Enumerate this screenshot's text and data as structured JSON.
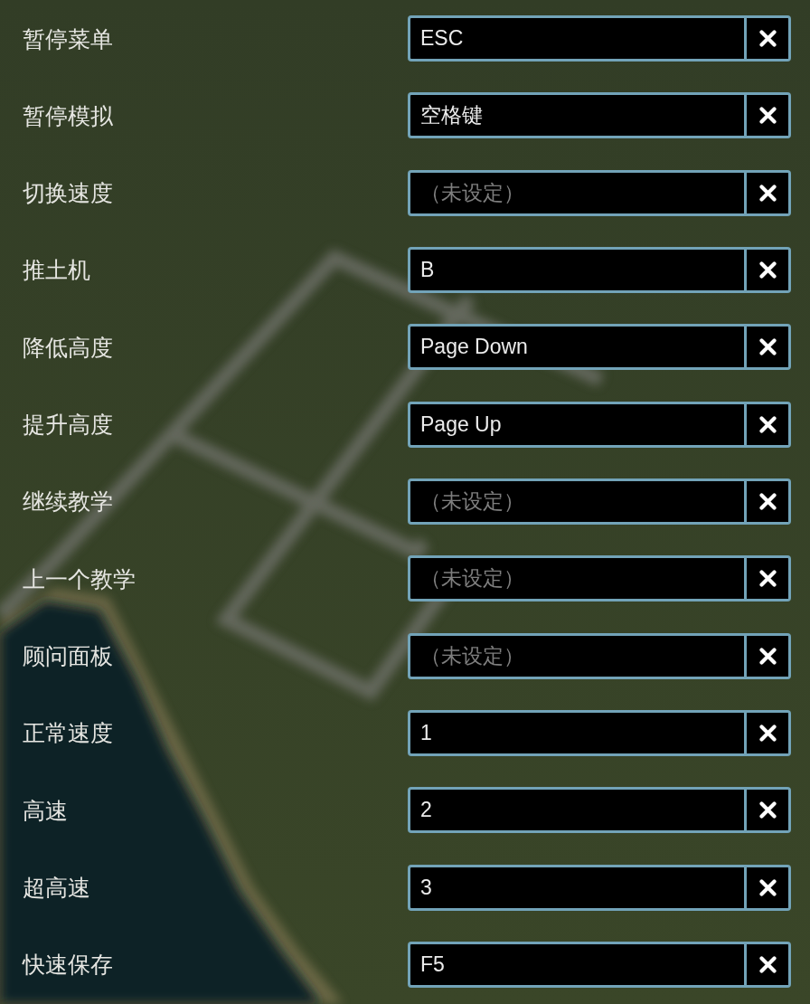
{
  "bindings": [
    {
      "label": "暂停菜单",
      "value": "ESC"
    },
    {
      "label": "暂停模拟",
      "value": "空格键"
    },
    {
      "label": "切换速度",
      "placeholder": "（未设定）"
    },
    {
      "label": "推土机",
      "value": "B"
    },
    {
      "label": "降低高度",
      "value": "Page Down"
    },
    {
      "label": "提升高度",
      "value": "Page Up"
    },
    {
      "label": "继续教学",
      "placeholder": "（未设定）"
    },
    {
      "label": "上一个教学",
      "placeholder": "（未设定）"
    },
    {
      "label": "顾问面板",
      "placeholder": "（未设定）"
    },
    {
      "label": "正常速度",
      "value": "1"
    },
    {
      "label": "高速",
      "value": "2"
    },
    {
      "label": "超高速",
      "value": "3"
    },
    {
      "label": "快速保存",
      "value": "F5"
    }
  ]
}
